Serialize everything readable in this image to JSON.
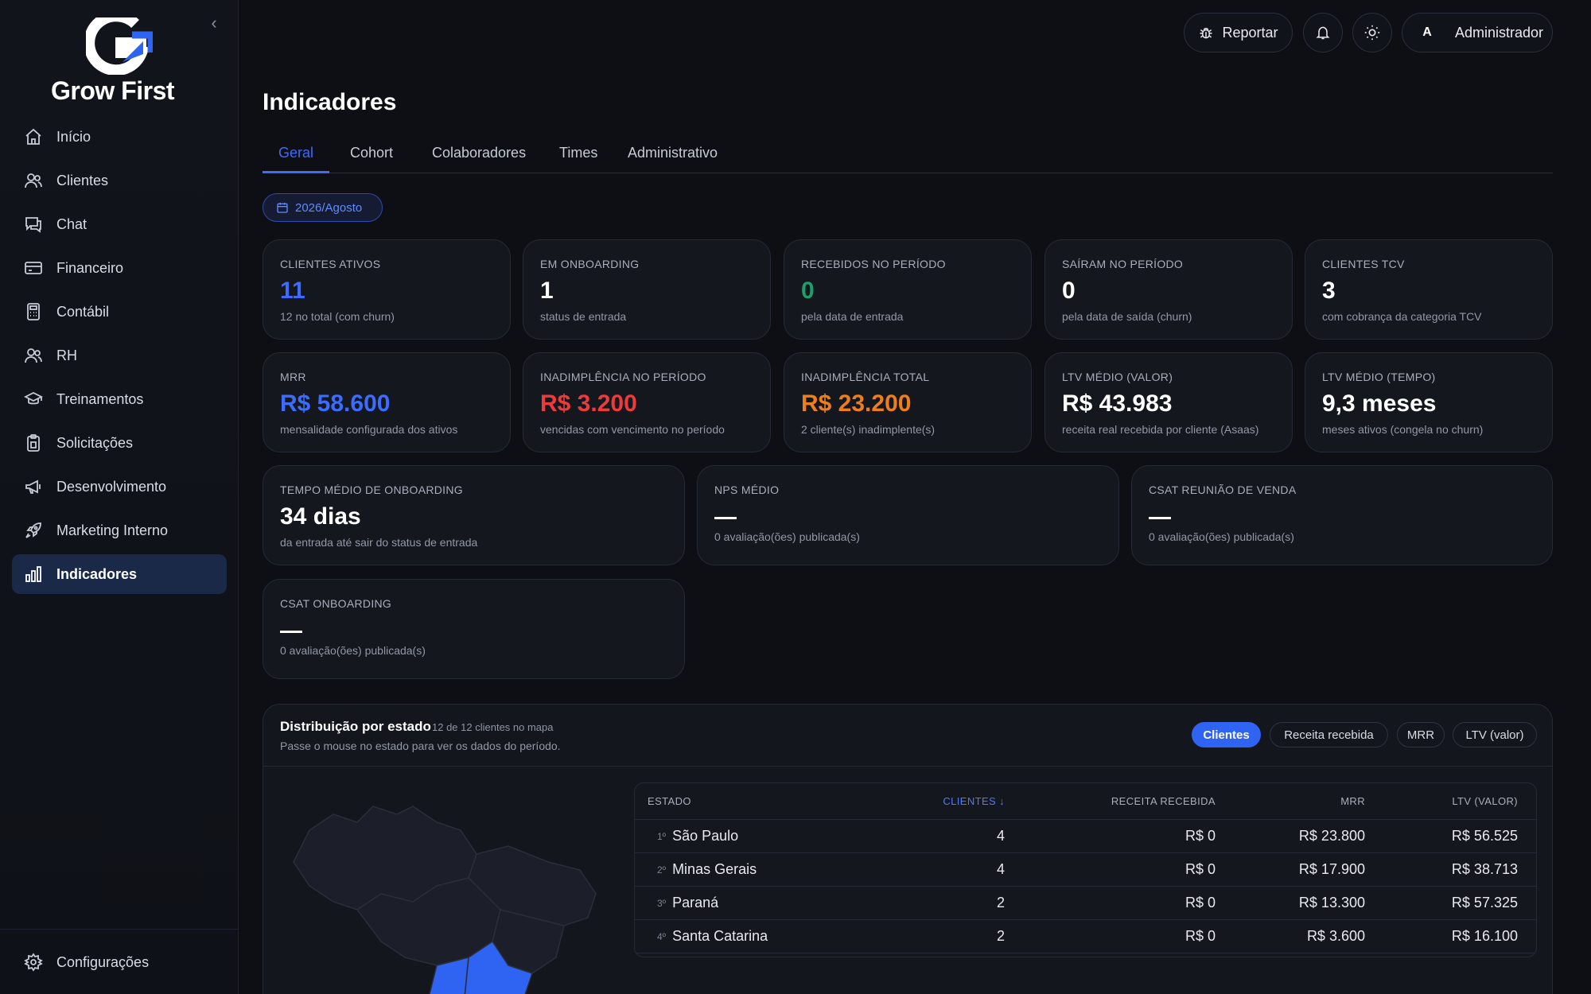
{
  "brand": {
    "name": "Grow First",
    "accent": "#3b6cff"
  },
  "sidebar": {
    "items": [
      {
        "label": "Início",
        "icon": "home-icon"
      },
      {
        "label": "Clientes",
        "icon": "users-icon"
      },
      {
        "label": "Chat",
        "icon": "chat-icon"
      },
      {
        "label": "Financeiro",
        "icon": "credit-card-icon"
      },
      {
        "label": "Contábil",
        "icon": "calculator-icon"
      },
      {
        "label": "RH",
        "icon": "people-icon"
      },
      {
        "label": "Treinamentos",
        "icon": "graduation-cap-icon"
      },
      {
        "label": "Solicitações",
        "icon": "clipboard-icon"
      },
      {
        "label": "Desenvolvimento",
        "icon": "megaphone-icon"
      },
      {
        "label": "Marketing Interno",
        "icon": "rocket-icon"
      },
      {
        "label": "Indicadores",
        "icon": "bar-chart-icon",
        "active": true
      }
    ],
    "settings_label": "Configurações"
  },
  "topbar": {
    "report_label": "Reportar",
    "user_initial": "A",
    "user_name": "Administrador"
  },
  "page": {
    "title": "Indicadores",
    "tabs": [
      "Geral",
      "Cohort",
      "Colaboradores",
      "Times",
      "Administrativo"
    ],
    "active_tab": "Geral",
    "period": "2026/Agosto"
  },
  "kpis": {
    "clientes_ativos": {
      "label": "CLIENTES ATIVOS",
      "value": "11",
      "sub": "12 no total (com churn)"
    },
    "em_onboarding": {
      "label": "EM ONBOARDING",
      "value": "1",
      "sub": "status de entrada"
    },
    "recebidos": {
      "label": "RECEBIDOS NO PERÍODO",
      "value": "0",
      "sub": "pela data de entrada"
    },
    "sairam": {
      "label": "SAÍRAM NO PERÍODO",
      "value": "0",
      "sub": "pela data de saída (churn)"
    },
    "clientes_tcv": {
      "label": "CLIENTES TCV",
      "value": "3",
      "sub": "com cobrança da categoria TCV"
    },
    "mrr": {
      "label": "MRR",
      "value": "R$ 58.600",
      "sub": "mensalidade configurada dos ativos"
    },
    "inad_periodo": {
      "label": "INADIMPLÊNCIA NO PERÍODO",
      "value": "R$ 3.200",
      "sub": "vencidas com vencimento no período"
    },
    "inad_total": {
      "label": "INADIMPLÊNCIA TOTAL",
      "value": "R$ 23.200",
      "sub": "2 cliente(s) inadimplente(s)"
    },
    "ltv_valor": {
      "label": "LTV MÉDIO (VALOR)",
      "value": "R$ 43.983",
      "sub": "receita real recebida por cliente (Asaas)"
    },
    "ltv_tempo": {
      "label": "LTV MÉDIO (TEMPO)",
      "value": "9,3 meses",
      "sub": "meses ativos (congela no churn)"
    },
    "tempo_onboarding": {
      "label": "TEMPO MÉDIO DE ONBOARDING",
      "value": "34 dias",
      "sub": "da entrada até sair do status de entrada"
    },
    "nps": {
      "label": "NPS MÉDIO",
      "sub": "0 avaliação(ões) publicada(s)"
    },
    "csat_venda": {
      "label": "CSAT REUNIÃO DE VENDA",
      "sub": "0 avaliação(ões) publicada(s)"
    },
    "csat_onboarding": {
      "label": "CSAT ONBOARDING",
      "sub": "0 avaliação(ões) publicada(s)"
    }
  },
  "distribution": {
    "title": "Distribuição por estado",
    "count": "12 de 12 clientes no mapa",
    "subtitle": "Passe o mouse no estado para ver os dados do período.",
    "metrics": [
      "Clientes",
      "Receita recebida",
      "MRR",
      "LTV (valor)"
    ],
    "active_metric": "Clientes",
    "columns": [
      "ESTADO",
      "CLIENTES ↓",
      "RECEITA RECEBIDA",
      "MRR",
      "LTV (VALOR)"
    ],
    "rows": [
      {
        "rank": "1º",
        "estado": "São Paulo",
        "clientes": "4",
        "receita": "R$ 0",
        "mrr": "R$ 23.800",
        "ltv": "R$ 56.525"
      },
      {
        "rank": "2º",
        "estado": "Minas Gerais",
        "clientes": "4",
        "receita": "R$ 0",
        "mrr": "R$ 17.900",
        "ltv": "R$ 38.713"
      },
      {
        "rank": "3º",
        "estado": "Paraná",
        "clientes": "2",
        "receita": "R$ 0",
        "mrr": "R$ 13.300",
        "ltv": "R$ 57.325"
      },
      {
        "rank": "4º",
        "estado": "Santa Catarina",
        "clientes": "2",
        "receita": "R$ 0",
        "mrr": "R$ 3.600",
        "ltv": "R$ 16.100"
      }
    ]
  }
}
